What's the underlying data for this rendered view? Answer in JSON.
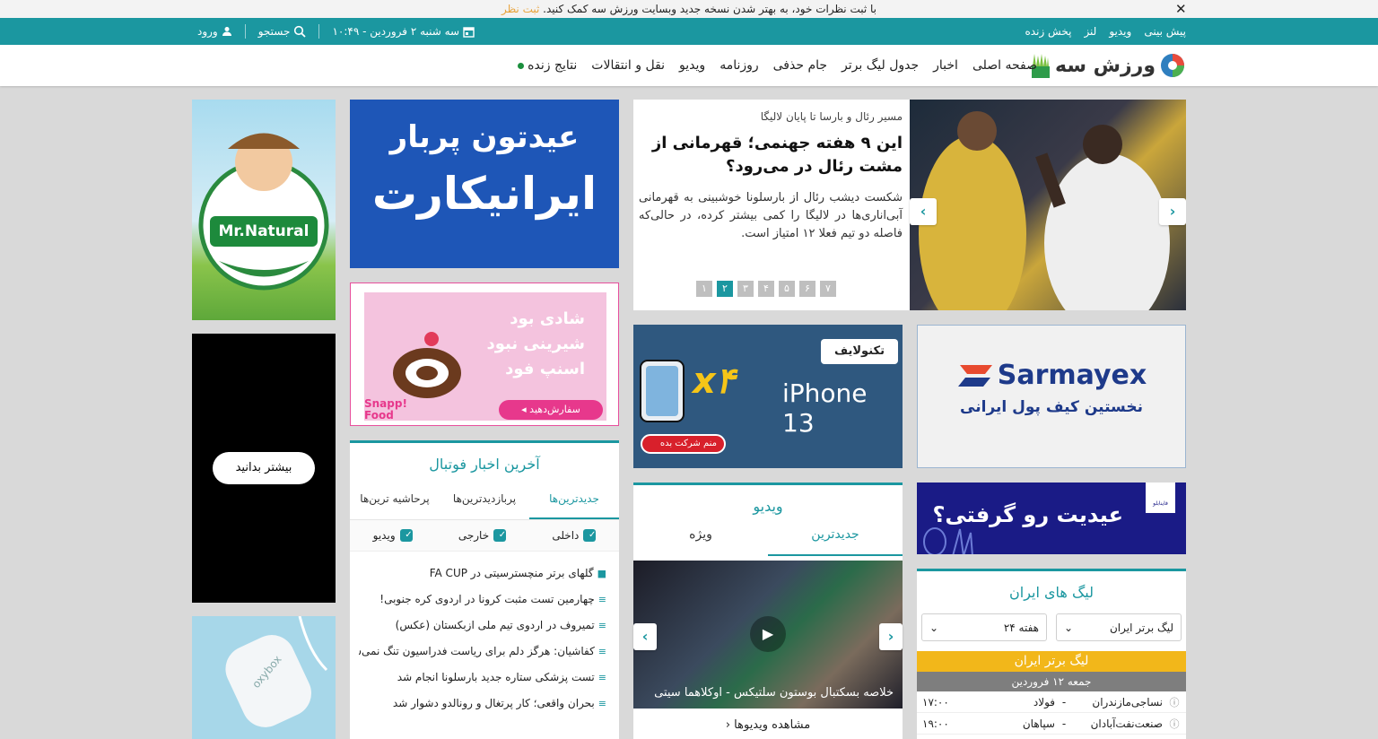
{
  "notice": {
    "text": "با ثبت نظرات خود، به بهتر شدن نسخه جدید وبسایت ورزش سه کمک کنید.",
    "link": "ثبت نظر"
  },
  "topbar": {
    "links": [
      "پیش بینی",
      "ویدیو",
      "لنز",
      "پخش زنده"
    ],
    "login": "ورود",
    "search": "جستجو",
    "date": "سه شنبه ۲ فروردین - ۱۰:۴۹"
  },
  "logo": {
    "text": "ورزش سه"
  },
  "nav": {
    "items": [
      "صفحه اصلی",
      "اخبار",
      "جدول لیگ برتر",
      "جام حذفی",
      "روزنامه",
      "ویدیو",
      "نقل و انتقالات",
      "نتایج زنده"
    ]
  },
  "hero": {
    "kicker": "مسیر رئال و بارسا تا پایان لالیگا",
    "headline": "این ۹ هفته جهنمی؛ قهرمانی از مشت رئال در می‌رود؟",
    "lead": "شکست دیشب رئال از بارسلونا خوشبینی به قهرمانی آبی‌اناری‌ها در لالیگا را کمی بیشتر کرده، در حالی‌که فاصله دو تیم فعلا ۱۲ امتیاز است.",
    "pages": [
      "۱",
      "۲",
      "۳",
      "۴",
      "۵",
      "۶",
      "۷"
    ],
    "active_page": 1
  },
  "ads": {
    "mrnatural": "Mr.Natural",
    "black_cta": "بیشتر بدانید",
    "oxybox": "oxybox",
    "iranicard_line1": "عیدتون پربار",
    "iranicard_line2": "ایرانیکارت",
    "snapp_line1": "شادی بود",
    "snapp_line2": "شیرینی نبود",
    "snapp_line3": "اسنپ فود",
    "snapp_cta": "سفارش‌دهید",
    "snapp_brand": "Snapp! Food",
    "techno_brand": "تکنولایف",
    "techno_model": "iPhone 13",
    "techno_x": "x۴",
    "techno_cta": "منم شرکت بده",
    "sarmayex_brand": "Sarmayex",
    "sarmayex_tagline": "نخستین کیف پول ایرانی",
    "eid_text": "عیدیت رو گرفتی؟",
    "eid_brand": "فاینابلو"
  },
  "football_news": {
    "title": "آخرین اخبار فوتبال",
    "tabs": [
      "جدیدترین‌ها",
      "پربازدیدترین‌ها",
      "پرحاشیه ترین‌ها"
    ],
    "filters": [
      "داخلی",
      "خارجی",
      "ویدیو"
    ],
    "items": [
      "گلهای برتر منچسترسیتی در FA CUP",
      "چهارمین تست مثبت کرونا در اردوی کره جنوبی!",
      "تمیروف در اردوی تیم ملی ازبکستان (عکس)",
      "کفاشیان: هرگز دلم برای ریاست فدراسیون تنگ نمی‌شود",
      "تست پزشکی ستاره جدید بارسلونا انجام شد",
      "بحران واقعی؛ کار پرتغال و رونالدو دشوار شد"
    ]
  },
  "video": {
    "title": "ویدیو",
    "tabs": [
      "جدیدترین",
      "ویژه"
    ],
    "caption": "خلاصه بسکتبال بوستون سلتیکس - اوکلاهما سیتی",
    "more": "مشاهده ویدیوها"
  },
  "league": {
    "title": "لیگ های ایران",
    "league_select": "لیگ برتر ایران",
    "week_select": "هفته ۲۴",
    "league_bar": "لیگ برتر ایران",
    "date": "جمعه ۱۲ فروردین",
    "matches": [
      {
        "home": "نساجی‌مازندران",
        "away": "فولاد",
        "time": "۱۷:۰۰"
      },
      {
        "home": "صنعت‌نفت‌آبادان",
        "away": "سپاهان",
        "time": "۱۹:۰۰"
      }
    ]
  },
  "colors": {
    "teal": "#1b97a0",
    "league_yellow": "#f2b71a",
    "live": "#1a8f3d"
  }
}
